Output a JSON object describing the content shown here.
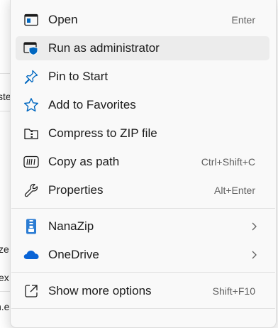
{
  "background": {
    "fragments": [
      "ste",
      "ze",
      "ex",
      "n.e"
    ]
  },
  "menu": {
    "items": [
      {
        "label": "Open",
        "shortcut": "Enter"
      },
      {
        "label": "Run as administrator",
        "shortcut": ""
      },
      {
        "label": "Pin to Start",
        "shortcut": ""
      },
      {
        "label": "Add to Favorites",
        "shortcut": ""
      },
      {
        "label": "Compress to ZIP file",
        "shortcut": ""
      },
      {
        "label": "Copy as path",
        "shortcut": "Ctrl+Shift+C"
      },
      {
        "label": "Properties",
        "shortcut": "Alt+Enter"
      },
      {
        "label": "NanaZip",
        "shortcut": ""
      },
      {
        "label": "OneDrive",
        "shortcut": ""
      },
      {
        "label": "Show more options",
        "shortcut": "Shift+F10"
      }
    ],
    "icons": [
      "open-icon",
      "shield-icon",
      "pin-icon",
      "star-icon",
      "zip-folder-icon",
      "copy-path-icon",
      "wrench-icon",
      "nanazip-icon",
      "onedrive-icon",
      "show-more-icon"
    ],
    "colors": {
      "accent": "#0067c0",
      "hover": "#ececec",
      "text": "#1b1b1b",
      "shortcut": "#5f5f5f"
    }
  }
}
